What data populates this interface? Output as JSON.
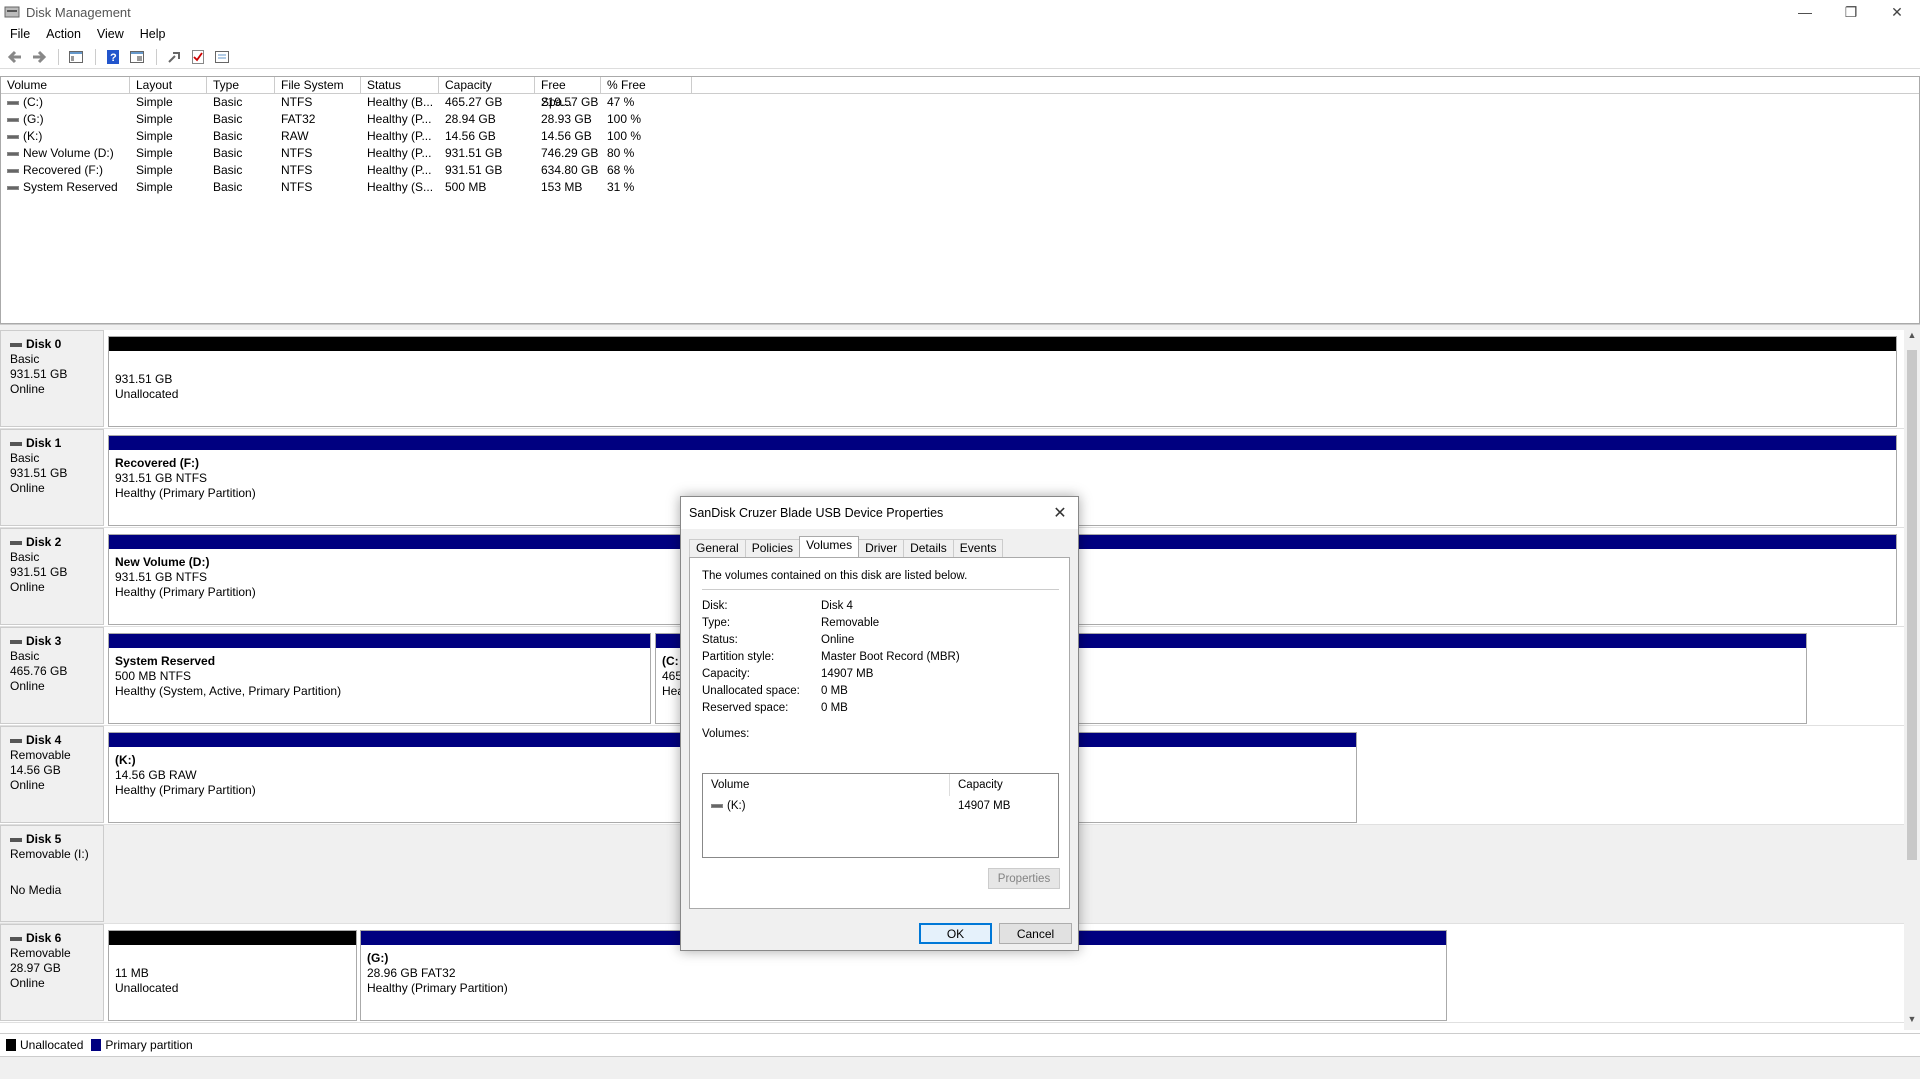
{
  "window": {
    "title": "Disk Management",
    "minimize": "—",
    "restore": "❐",
    "close": "✕"
  },
  "menu": [
    "File",
    "Action",
    "View",
    "Help"
  ],
  "volume_list": {
    "headers": [
      "Volume",
      "Layout",
      "Type",
      "File System",
      "Status",
      "Capacity",
      "Free Spa...",
      "% Free"
    ],
    "rows": [
      [
        "(C:)",
        "Simple",
        "Basic",
        "NTFS",
        "Healthy (B...",
        "465.27 GB",
        "219.57 GB",
        "47 %"
      ],
      [
        "(G:)",
        "Simple",
        "Basic",
        "FAT32",
        "Healthy (P...",
        "28.94 GB",
        "28.93 GB",
        "100 %"
      ],
      [
        "(K:)",
        "Simple",
        "Basic",
        "RAW",
        "Healthy (P...",
        "14.56 GB",
        "14.56 GB",
        "100 %"
      ],
      [
        "New Volume (D:)",
        "Simple",
        "Basic",
        "NTFS",
        "Healthy (P...",
        "931.51 GB",
        "746.29 GB",
        "80 %"
      ],
      [
        "Recovered (F:)",
        "Simple",
        "Basic",
        "NTFS",
        "Healthy (P...",
        "931.51 GB",
        "634.80 GB",
        "68 %"
      ],
      [
        "System Reserved",
        "Simple",
        "Basic",
        "NTFS",
        "Healthy (S...",
        "500 MB",
        "153 MB",
        "31 %"
      ]
    ]
  },
  "disks": [
    {
      "name": "Disk 0",
      "type": "Basic",
      "size": "931.51 GB",
      "status": "Online",
      "parts": [
        {
          "title": "",
          "line1": "931.51 GB",
          "line2": "Unallocated",
          "kind": "unallocated"
        }
      ]
    },
    {
      "name": "Disk 1",
      "type": "Basic",
      "size": "931.51 GB",
      "status": "Online",
      "parts": [
        {
          "title": "Recovered  (F:)",
          "line1": "931.51 GB NTFS",
          "line2": "Healthy (Primary Partition)",
          "kind": "primary"
        }
      ]
    },
    {
      "name": "Disk 2",
      "type": "Basic",
      "size": "931.51 GB",
      "status": "Online",
      "parts": [
        {
          "title": "New Volume  (D:)",
          "line1": "931.51 GB NTFS",
          "line2": "Healthy (Primary Partition)",
          "kind": "primary"
        }
      ]
    },
    {
      "name": "Disk 3",
      "type": "Basic",
      "size": "465.76 GB",
      "status": "Online",
      "parts": [
        {
          "title": "System Reserved",
          "line1": "500 MB NTFS",
          "line2": "Healthy (System, Active, Primary Partition)",
          "kind": "primary"
        },
        {
          "title": "(C:",
          "line1": "465",
          "line2": "Hea",
          "kind": "primary"
        }
      ]
    },
    {
      "name": "Disk 4",
      "type": "Removable",
      "size": "14.56 GB",
      "status": "Online",
      "parts": [
        {
          "title": "(K:)",
          "line1": "14.56 GB RAW",
          "line2": "Healthy (Primary Partition)",
          "kind": "primary"
        }
      ]
    },
    {
      "name": "Disk 5",
      "type": "Removable (I:)",
      "size": "",
      "status": "No Media",
      "parts": []
    },
    {
      "name": "Disk 6",
      "type": "Removable",
      "size": "28.97 GB",
      "status": "Online",
      "parts": [
        {
          "title": "",
          "line1": "11 MB",
          "line2": "Unallocated",
          "kind": "unallocated"
        },
        {
          "title": "(G:)",
          "line1": "28.96 GB FAT32",
          "line2": "Healthy (Primary Partition)",
          "kind": "primary"
        }
      ]
    }
  ],
  "legend": {
    "unallocated": "Unallocated",
    "primary": "Primary partition",
    "unallocated_color": "#000000",
    "primary_color": "#000080"
  },
  "dialog": {
    "title": "SanDisk Cruzer Blade USB Device Properties",
    "tabs": [
      "General",
      "Policies",
      "Volumes",
      "Driver",
      "Details",
      "Events"
    ],
    "active_tab": "Volumes",
    "intro": "The volumes contained on this disk are listed below.",
    "fields": [
      {
        "label": "Disk:",
        "value": "Disk 4"
      },
      {
        "label": "Type:",
        "value": "Removable"
      },
      {
        "label": "Status:",
        "value": "Online"
      },
      {
        "label": "Partition style:",
        "value": "Master Boot Record (MBR)"
      },
      {
        "label": "Capacity:",
        "value": "14907 MB"
      },
      {
        "label": "Unallocated space:",
        "value": "0 MB"
      },
      {
        "label": "Reserved space:",
        "value": "0 MB"
      }
    ],
    "volumes_label": "Volumes:",
    "volumes_headers": [
      "Volume",
      "Capacity"
    ],
    "volumes_rows": [
      [
        "(K:)",
        "14907 MB"
      ]
    ],
    "properties_button": "Properties",
    "ok": "OK",
    "cancel": "Cancel"
  }
}
